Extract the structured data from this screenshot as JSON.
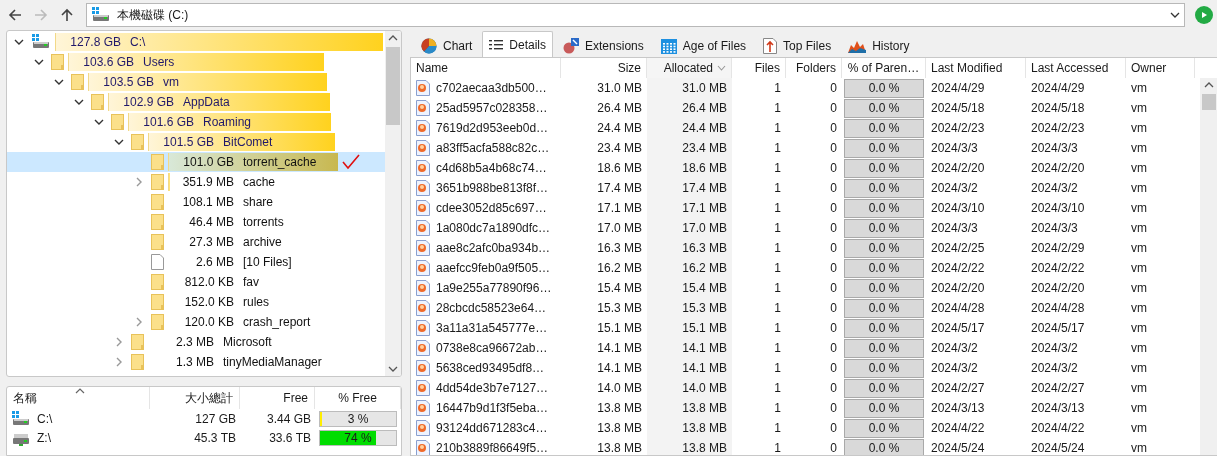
{
  "toolbar": {
    "address": "本機磁碟 (C:)"
  },
  "tree": {
    "nodes": [
      {
        "kind": "drive",
        "size": "127.8 GB",
        "name": "C:\\",
        "expanded": true,
        "selected": false,
        "children": [
          {
            "kind": "folder",
            "size": "103.6 GB",
            "name": "Users",
            "expanded": true,
            "selected": false,
            "children": [
              {
                "kind": "folder",
                "size": "103.5 GB",
                "name": "vm",
                "expanded": true,
                "selected": false,
                "children": [
                  {
                    "kind": "folder",
                    "size": "102.9 GB",
                    "name": "AppData",
                    "expanded": true,
                    "selected": false,
                    "children": [
                      {
                        "kind": "folder",
                        "size": "101.6 GB",
                        "name": "Roaming",
                        "expanded": true,
                        "selected": false,
                        "children": [
                          {
                            "kind": "folder",
                            "size": "101.5 GB",
                            "name": "BitComet",
                            "expanded": true,
                            "selected": false,
                            "children": [
                              {
                                "kind": "folder",
                                "size": "101.0 GB",
                                "name": "torrent_cache",
                                "selected": true
                              },
                              {
                                "kind": "folder",
                                "size": "351.9 MB",
                                "name": "cache",
                                "expanded": false,
                                "selected": false
                              },
                              {
                                "kind": "folder",
                                "size": "108.1 MB",
                                "name": "share",
                                "selected": false
                              },
                              {
                                "kind": "folder",
                                "size": "46.4 MB",
                                "name": "torrents",
                                "selected": false
                              },
                              {
                                "kind": "folder",
                                "size": "27.3 MB",
                                "name": "archive",
                                "selected": false
                              },
                              {
                                "kind": "files",
                                "size": "2.6 MB",
                                "name": "[10 Files]",
                                "selected": false
                              },
                              {
                                "kind": "folder",
                                "size": "812.0 KB",
                                "name": "fav",
                                "selected": false
                              },
                              {
                                "kind": "folder",
                                "size": "152.0 KB",
                                "name": "rules",
                                "selected": false
                              },
                              {
                                "kind": "folder",
                                "size": "120.0 KB",
                                "name": "crash_report",
                                "expanded": false,
                                "selected": false
                              }
                            ]
                          },
                          {
                            "kind": "folder",
                            "size": "2.3 MB",
                            "name": "Microsoft",
                            "expanded": false,
                            "selected": false
                          },
                          {
                            "kind": "folder",
                            "size": "1.3 MB",
                            "name": "tinyMediaManager",
                            "expanded": false,
                            "selected": false
                          }
                        ]
                      }
                    ]
                  }
                ]
              }
            ]
          }
        ]
      }
    ]
  },
  "drives": {
    "columns": [
      "名稱",
      "大小總計",
      "Free",
      "% Free"
    ],
    "rows": [
      {
        "kind": "local",
        "name": "C:\\",
        "total": "127 GB",
        "free": "3.44 GB",
        "percent": "3 %",
        "level": 0.03,
        "color": "#ffee00"
      },
      {
        "kind": "network",
        "name": "Z:\\",
        "total": "45.3 TB",
        "free": "33.6 TB",
        "percent": "74 %",
        "level": 0.74,
        "color": "#00dd00"
      }
    ]
  },
  "tabs": [
    {
      "kind": "chart",
      "label": "Chart",
      "selected": false
    },
    {
      "kind": "details",
      "label": "Details",
      "selected": true
    },
    {
      "kind": "extensions",
      "label": "Extensions",
      "selected": false
    },
    {
      "kind": "age",
      "label": "Age of Files",
      "selected": false
    },
    {
      "kind": "top",
      "label": "Top Files",
      "selected": false
    },
    {
      "kind": "history",
      "label": "History",
      "selected": false
    }
  ],
  "table": {
    "columns": [
      {
        "label": "Name",
        "sorted": false
      },
      {
        "label": "Size",
        "sorted": false
      },
      {
        "label": "Allocated",
        "sorted": true
      },
      {
        "label": "Files",
        "sorted": false
      },
      {
        "label": "Folders",
        "sorted": false
      },
      {
        "label": "% of Paren…",
        "sorted": false
      },
      {
        "label": "Last Modified",
        "sorted": false
      },
      {
        "label": "Last Accessed",
        "sorted": false
      },
      {
        "label": "Owner",
        "sorted": false
      }
    ],
    "rows": [
      [
        "c702aecaa3db500…",
        "31.0 MB",
        "31.0 MB",
        "1",
        "0",
        "0.0 %",
        "2024/4/29",
        "2024/4/29",
        "vm"
      ],
      [
        "25ad5957c028358…",
        "26.4 MB",
        "26.4 MB",
        "1",
        "0",
        "0.0 %",
        "2024/5/18",
        "2024/5/18",
        "vm"
      ],
      [
        "7619d2d953eeb0d…",
        "24.4 MB",
        "24.4 MB",
        "1",
        "0",
        "0.0 %",
        "2024/2/23",
        "2024/2/23",
        "vm"
      ],
      [
        "a83ff5acfa588c82c…",
        "23.4 MB",
        "23.4 MB",
        "1",
        "0",
        "0.0 %",
        "2024/3/3",
        "2024/3/3",
        "vm"
      ],
      [
        "c4d68b5a4b68c74…",
        "18.6 MB",
        "18.6 MB",
        "1",
        "0",
        "0.0 %",
        "2024/2/20",
        "2024/2/20",
        "vm"
      ],
      [
        "3651b988be813f8f…",
        "17.4 MB",
        "17.4 MB",
        "1",
        "0",
        "0.0 %",
        "2024/3/2",
        "2024/3/2",
        "vm"
      ],
      [
        "cdee3052d85c697…",
        "17.1 MB",
        "17.1 MB",
        "1",
        "0",
        "0.0 %",
        "2024/3/10",
        "2024/3/10",
        "vm"
      ],
      [
        "1a080dc7a1890dfc…",
        "17.0 MB",
        "17.0 MB",
        "1",
        "0",
        "0.0 %",
        "2024/3/3",
        "2024/3/3",
        "vm"
      ],
      [
        "aae8c2afc0ba934b…",
        "16.3 MB",
        "16.3 MB",
        "1",
        "0",
        "0.0 %",
        "2024/2/25",
        "2024/2/29",
        "vm"
      ],
      [
        "aaefcc9feb0a9f505…",
        "16.2 MB",
        "16.2 MB",
        "1",
        "0",
        "0.0 %",
        "2024/2/22",
        "2024/2/22",
        "vm"
      ],
      [
        "1a9e255a77890f96…",
        "15.4 MB",
        "15.4 MB",
        "1",
        "0",
        "0.0 %",
        "2024/2/20",
        "2024/2/20",
        "vm"
      ],
      [
        "28cbcdc58523e64…",
        "15.3 MB",
        "15.3 MB",
        "1",
        "0",
        "0.0 %",
        "2024/4/28",
        "2024/4/28",
        "vm"
      ],
      [
        "3a11a31a545777e…",
        "15.1 MB",
        "15.1 MB",
        "1",
        "0",
        "0.0 %",
        "2024/5/17",
        "2024/5/17",
        "vm"
      ],
      [
        "0738e8ca96672ab…",
        "14.1 MB",
        "14.1 MB",
        "1",
        "0",
        "0.0 %",
        "2024/3/2",
        "2024/3/2",
        "vm"
      ],
      [
        "5638ced93495df8…",
        "14.1 MB",
        "14.1 MB",
        "1",
        "0",
        "0.0 %",
        "2024/3/2",
        "2024/3/2",
        "vm"
      ],
      [
        "4dd54de3b7e7127…",
        "14.0 MB",
        "14.0 MB",
        "1",
        "0",
        "0.0 %",
        "2024/2/27",
        "2024/2/27",
        "vm"
      ],
      [
        "16447b9d1f3f5eba…",
        "13.8 MB",
        "13.8 MB",
        "1",
        "0",
        "0.0 %",
        "2024/3/13",
        "2024/3/13",
        "vm"
      ],
      [
        "93124dd671283c4…",
        "13.8 MB",
        "13.8 MB",
        "1",
        "0",
        "0.0 %",
        "2024/4/22",
        "2024/4/22",
        "vm"
      ],
      [
        "210b3889f86649f5…",
        "13.8 MB",
        "13.8 MB",
        "1",
        "0",
        "0.0 %",
        "2024/5/24",
        "2024/5/24",
        "vm"
      ]
    ]
  }
}
